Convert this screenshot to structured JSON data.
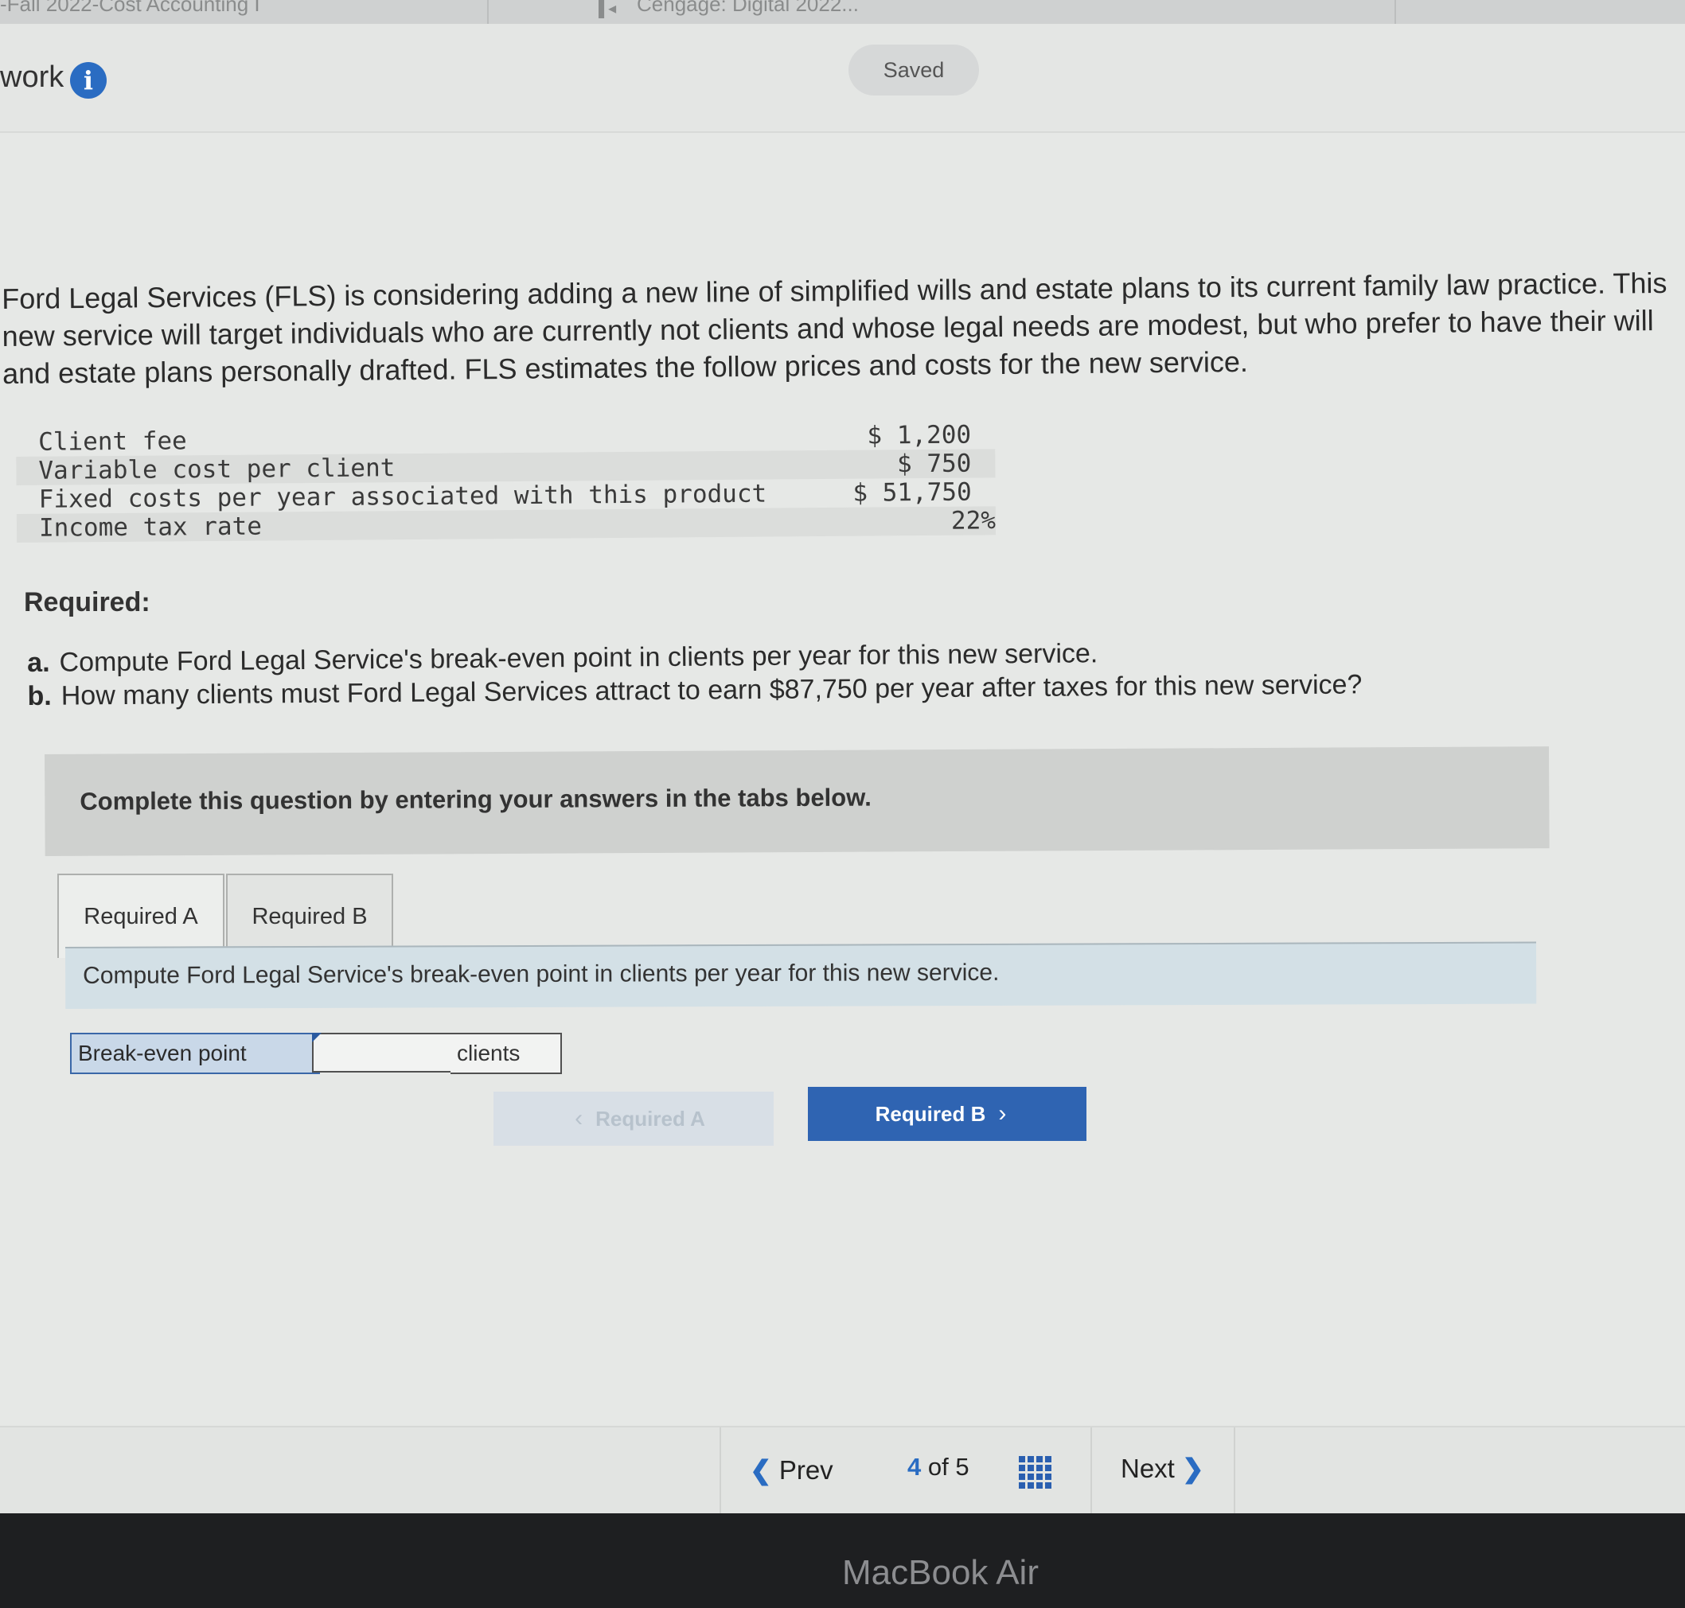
{
  "browser": {
    "tab_title": "-Fall 2022-Cost Accounting I",
    "tab_title_2": "Cengage: Digital 2022..."
  },
  "header": {
    "title": "work",
    "status": "Saved"
  },
  "problem": {
    "intro_lines": [
      "Ford Legal Services (FLS) is considering adding a new line of simplified wills and estate plans to its current family law practice. This",
      "new service will target individuals who are currently not clients and whose legal needs are modest, but who prefer to have their will",
      "and estate plans personally drafted. FLS estimates the follow prices and costs for the new service."
    ],
    "costs": [
      {
        "label": "Client fee",
        "value": "$ 1,200"
      },
      {
        "label": "Variable cost per client",
        "value": "$ 750"
      },
      {
        "label": "Fixed costs per year associated with this product",
        "value": "$ 51,750"
      },
      {
        "label": "Income tax rate",
        "value": "22%"
      }
    ],
    "required_heading": "Required:",
    "requirements": [
      {
        "letter": "a.",
        "text": "Compute Ford Legal Service's break-even point in clients per year for this new service."
      },
      {
        "letter": "b.",
        "text": "How many clients must Ford Legal Services attract to earn $87,750 per year after taxes for this new service?"
      }
    ]
  },
  "instructions": "Complete this question by entering your answers in the tabs below.",
  "tabs": [
    {
      "label": "Required A"
    },
    {
      "label": "Required B"
    }
  ],
  "panel": {
    "prompt": "Compute Ford Legal Service's break-even point in clients per year for this new service.",
    "answer_label": "Break-even point",
    "answer_value": "",
    "answer_unit": "clients"
  },
  "nav": {
    "prev_label": "Required A",
    "next_label": "Required B"
  },
  "footer": {
    "prev": "Prev",
    "current_page": "4",
    "of": "of",
    "total_pages": "5",
    "next": "Next"
  },
  "device": {
    "brand": "MacBook Air"
  }
}
